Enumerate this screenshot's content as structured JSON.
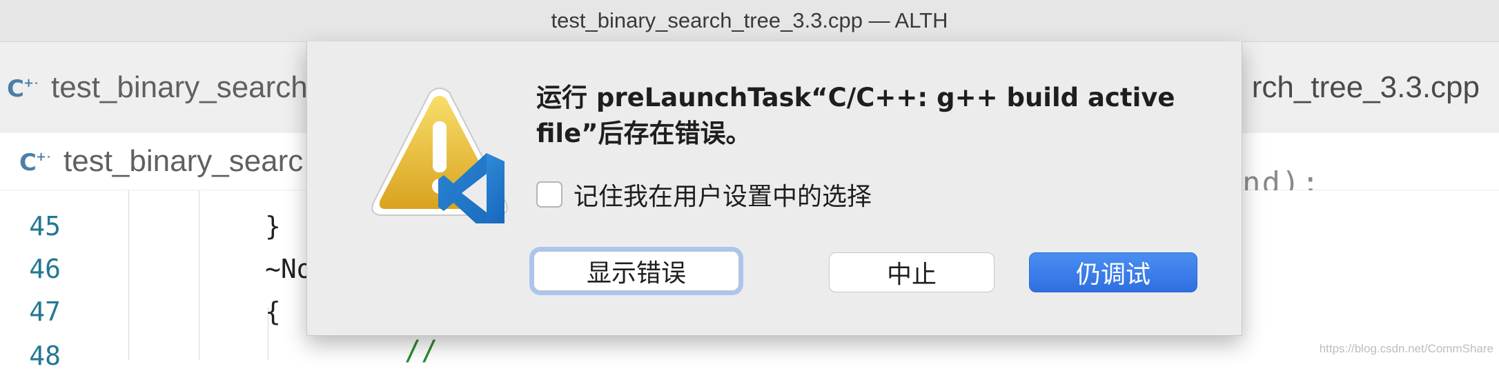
{
  "window": {
    "title": "test_binary_search_tree_3.3.cpp — ALTH"
  },
  "tabs": {
    "left_tab_label": "test_binary_search",
    "right_tab_label": "rch_tree_3.3.cpp",
    "icon": "cpp-file-icon"
  },
  "breadcrumb": {
    "label": "test_binary_searc"
  },
  "editor": {
    "line_numbers": [
      "45",
      "46",
      "47",
      "48"
    ],
    "code_lines": [
      "}",
      "~No",
      "{"
    ],
    "comment_fragment": "//",
    "right_fragment": "nd);",
    "colors": {
      "line_number": "#237893",
      "comment": "#2f8a2f"
    }
  },
  "dialog": {
    "message": "运行 preLaunchTask“C/C++: g++ build active file”后存在错误。",
    "remember_label": "记住我在用户设置中的选择",
    "buttons": {
      "show_errors": "显示错误",
      "abort": "中止",
      "debug_anyway": "仍调试"
    },
    "icon": "warning-vscode-icon",
    "colors": {
      "primary_button": "#3478f6",
      "focus_ring": "#a9c6ee"
    }
  },
  "watermark": "https://blog.csdn.net/CommShare"
}
